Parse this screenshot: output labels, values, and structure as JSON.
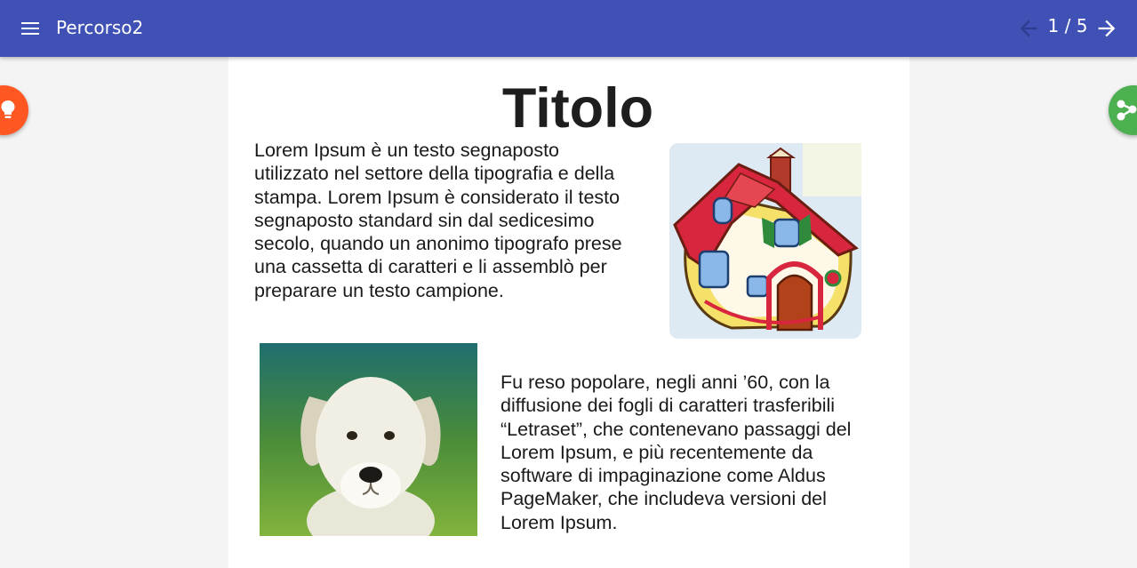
{
  "app_bar": {
    "menu_icon": "menu-icon",
    "title": "Percorso2",
    "prev_icon": "arrow-back-icon",
    "next_icon": "arrow-forward-icon",
    "page_counter": "1 / 5",
    "colors": {
      "background": "#3f51b5",
      "prev_arrow": "#2f3c8e",
      "next_arrow": "#ffffff"
    }
  },
  "page": {
    "title": "Titolo",
    "paragraph_1": "Lorem Ipsum è un testo segnaposto utilizzato nel settore della tipografia e della stampa. Lorem Ipsum è considerato il testo segnaposto standard sin dal sedicesimo secolo, quando un anonimo tipografo prese una cassetta di caratteri e li assemblò per preparare un testo campione.",
    "paragraph_2": "Fu reso popolare, negli anni ’60, con la diffusione dei fogli di caratteri trasferibili “Letraset”, che contenevano passaggi del Lorem Ipsum, e più recentemente da software di impaginazione come Aldus PageMaker, che includeva versioni del Lorem Ipsum.",
    "images": [
      "house-illustration",
      "puppy-photo"
    ]
  },
  "fabs": {
    "left": {
      "icon": "lightbulb-icon",
      "color": "#ff5722"
    },
    "right": {
      "icon": "share-icon",
      "color": "#4caf50"
    }
  }
}
